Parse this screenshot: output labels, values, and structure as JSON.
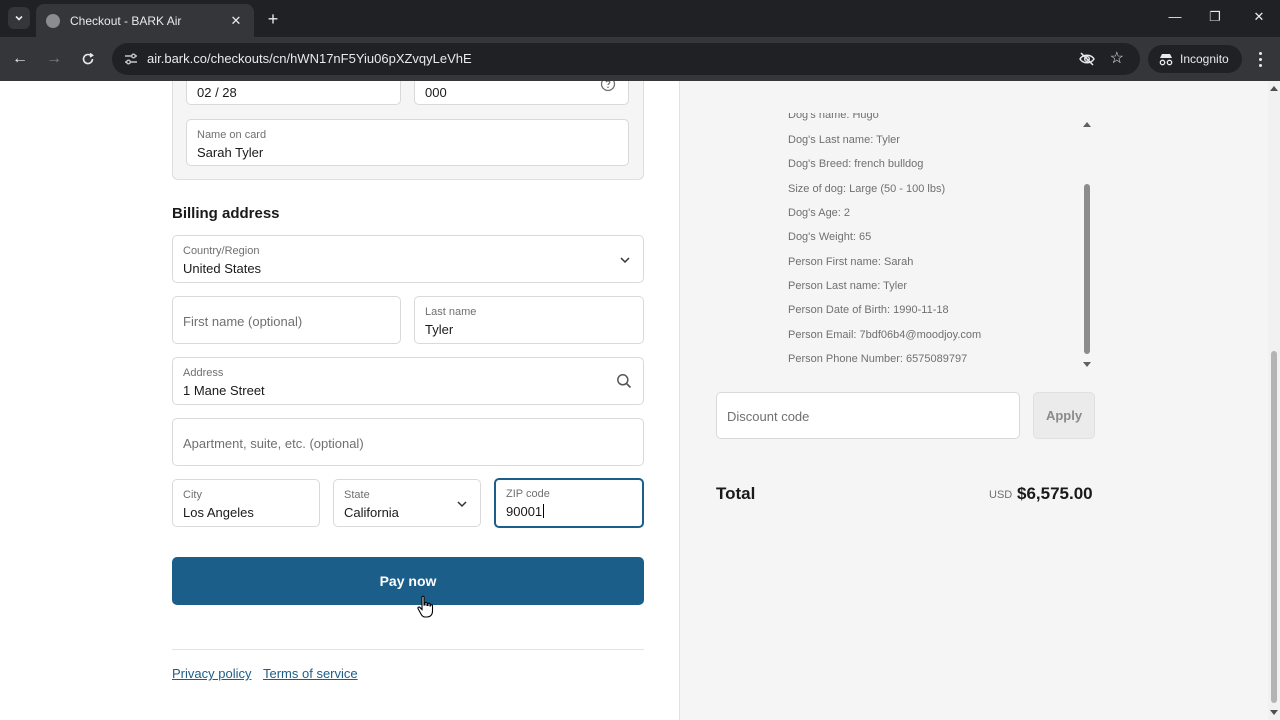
{
  "browser": {
    "tab_title": "Checkout - BARK Air",
    "url": "air.bark.co/checkouts/cn/hWN17nF5Yiu06pXZvqyLeVhE",
    "incognito_label": "Incognito"
  },
  "card": {
    "expiry_value": "02 / 28",
    "cvv_value": "000",
    "name_label": "Name on card",
    "name_value": "Sarah Tyler"
  },
  "billing": {
    "title": "Billing address",
    "country_label": "Country/Region",
    "country_value": "United States",
    "first_name_placeholder": "First name (optional)",
    "last_name_label": "Last name",
    "last_name_value": "Tyler",
    "address_label": "Address",
    "address_value": "1 Mane Street",
    "apartment_placeholder": "Apartment, suite, etc. (optional)",
    "city_label": "City",
    "city_value": "Los Angeles",
    "state_label": "State",
    "state_value": "California",
    "zip_label": "ZIP code",
    "zip_value": "90001"
  },
  "pay_button": "Pay now",
  "footer": {
    "privacy": "Privacy policy",
    "terms": "Terms of service"
  },
  "order_properties": [
    "Dog's name: Hugo",
    "Dog's Last name: Tyler",
    "Dog's Breed: french bulldog",
    "Size of dog: Large (50 - 100 lbs)",
    "Dog's Age: 2",
    "Dog's Weight: 65",
    "Person First name: Sarah",
    "Person Last name: Tyler",
    "Person Date of Birth: 1990-11-18",
    "Person Email: 7bdf06b4@moodjoy.com",
    "Person Phone Number: 6575089797"
  ],
  "discount": {
    "placeholder": "Discount code",
    "apply_label": "Apply"
  },
  "summary": {
    "total_label": "Total",
    "currency": "USD",
    "total_amount": "$6,575.00"
  },
  "colors": {
    "accent": "#1b5e8a",
    "chrome_dark": "#202124",
    "chrome_mid": "#35363a",
    "summary_bg": "#f5f5f5"
  }
}
